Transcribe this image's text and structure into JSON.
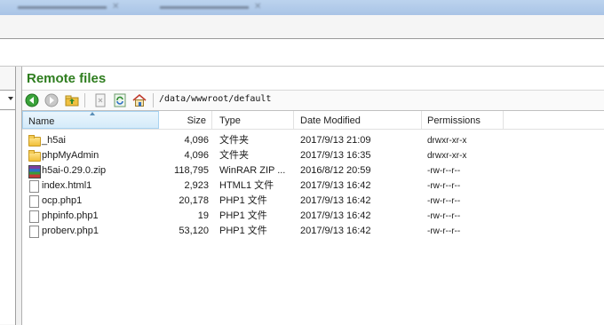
{
  "colors": {
    "title_green": "#2e7d1e",
    "header_selected": "#d4ebfa"
  },
  "remote": {
    "title": "Remote files",
    "path": "/data/wwwroot/default",
    "toolbar_icons": [
      "back-icon",
      "forward-icon",
      "parent-folder-icon",
      "delete-icon",
      "refresh-icon",
      "home-icon"
    ]
  },
  "table": {
    "headers": {
      "name": "Name",
      "size": "Size",
      "type": "Type",
      "date": "Date Modified",
      "permissions": "Permissions"
    },
    "rows": [
      {
        "icon": "folder-icon",
        "name": "_h5ai",
        "size": "4,096",
        "type": "文件夹",
        "date": "2017/9/13 21:09",
        "perm": "drwxr-xr-x"
      },
      {
        "icon": "folder-icon",
        "name": "phpMyAdmin",
        "size": "4,096",
        "type": "文件夹",
        "date": "2017/9/13 16:35",
        "perm": "drwxr-xr-x"
      },
      {
        "icon": "winrar-icon",
        "name": "h5ai-0.29.0.zip",
        "size": "118,795",
        "type": "WinRAR ZIP ...",
        "date": "2016/8/12 20:59",
        "perm": "-rw-r--r--"
      },
      {
        "icon": "file-icon",
        "name": "index.html1",
        "size": "2,923",
        "type": "HTML1 文件",
        "date": "2017/9/13 16:42",
        "perm": "-rw-r--r--"
      },
      {
        "icon": "file-icon",
        "name": "ocp.php1",
        "size": "20,178",
        "type": "PHP1 文件",
        "date": "2017/9/13 16:42",
        "perm": "-rw-r--r--"
      },
      {
        "icon": "file-icon",
        "name": "phpinfo.php1",
        "size": "19",
        "type": "PHP1 文件",
        "date": "2017/9/13 16:42",
        "perm": "-rw-r--r--"
      },
      {
        "icon": "file-icon",
        "name": "proberv.php1",
        "size": "53,120",
        "type": "PHP1 文件",
        "date": "2017/9/13 16:42",
        "perm": "-rw-r--r--"
      }
    ]
  }
}
